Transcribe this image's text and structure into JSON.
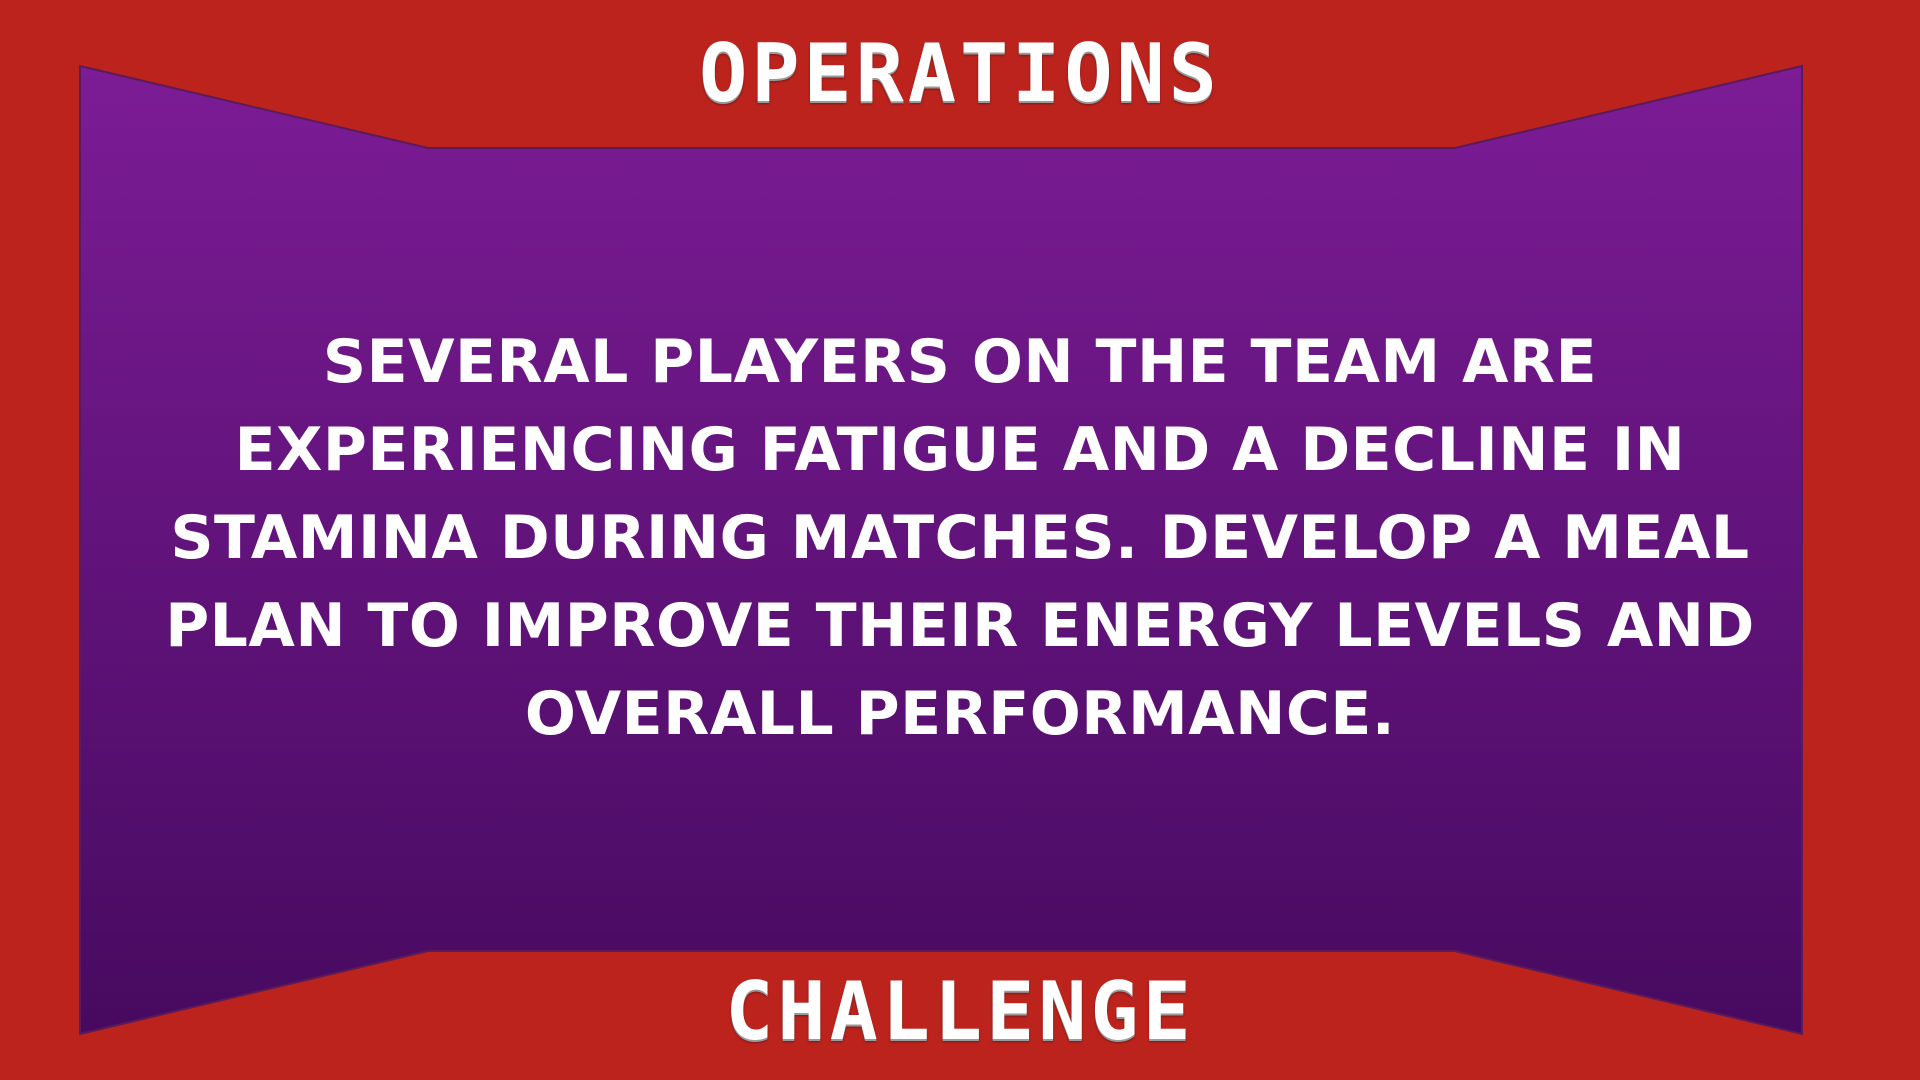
{
  "slide": {
    "title": "OPERATIONS",
    "subtitle": "CHALLENGE",
    "body": "SEVERAL PLAYERS ON THE TEAM ARE EXPERIENCING FATIGUE AND A DECLINE IN STAMINA DURING MATCHES. DEVELOP A MEAL PLAN TO IMPROVE THEIR ENERGY LEVELS AND OVERALL PERFORMANCE."
  },
  "colors": {
    "frame": "#bc231d",
    "panel_top": "#7c1c96",
    "panel_bottom": "#470a60",
    "text": "#ffffff"
  }
}
